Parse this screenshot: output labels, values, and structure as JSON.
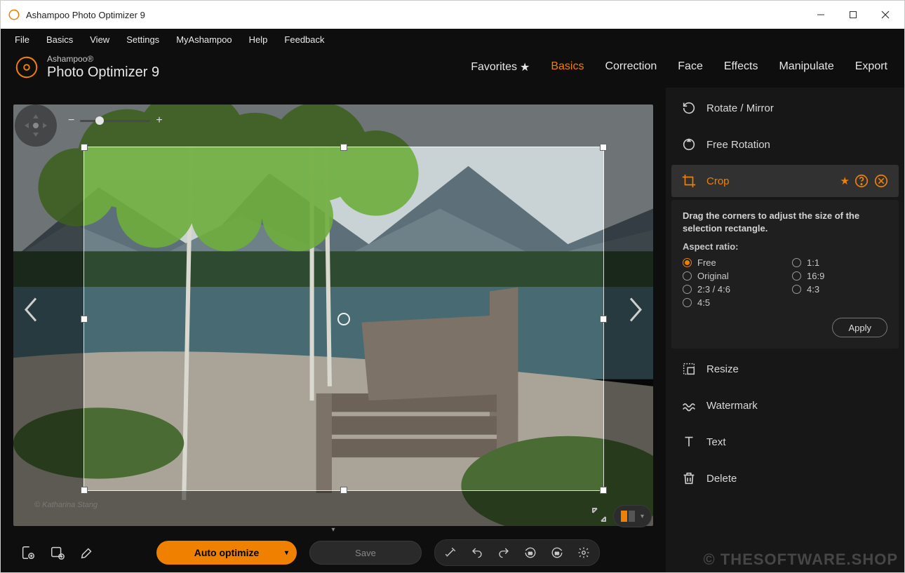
{
  "window": {
    "title": "Ashampoo Photo Optimizer 9"
  },
  "menu": [
    "File",
    "Basics",
    "View",
    "Settings",
    "MyAshampoo",
    "Help",
    "Feedback"
  ],
  "brand": {
    "line1": "Ashampoo®",
    "line2": "Photo Optimizer 9"
  },
  "tabs": {
    "favorites": "Favorites",
    "items": [
      "Basics",
      "Correction",
      "Face",
      "Effects",
      "Manipulate",
      "Export"
    ],
    "active": "Basics"
  },
  "side": {
    "rotate_mirror": "Rotate / Mirror",
    "free_rotation": "Free Rotation",
    "crop": "Crop",
    "resize": "Resize",
    "watermark": "Watermark",
    "text": "Text",
    "delete": "Delete"
  },
  "crop_panel": {
    "description": "Drag the corners to adjust the size of the selection rectangle.",
    "aspect_label": "Aspect ratio:",
    "ratios": {
      "free": "Free",
      "one_one": "1:1",
      "original": "Original",
      "sixteen_nine": "16:9",
      "two_three": "2:3 / 4:6",
      "four_three": "4:3",
      "four_five": "4:5"
    },
    "selected": "free",
    "apply": "Apply"
  },
  "bottom": {
    "auto_optimize": "Auto optimize",
    "save": "Save"
  },
  "canvas": {
    "credit": "© Katharina Stang"
  },
  "watermark": "© THESOFTWARE.SHOP"
}
